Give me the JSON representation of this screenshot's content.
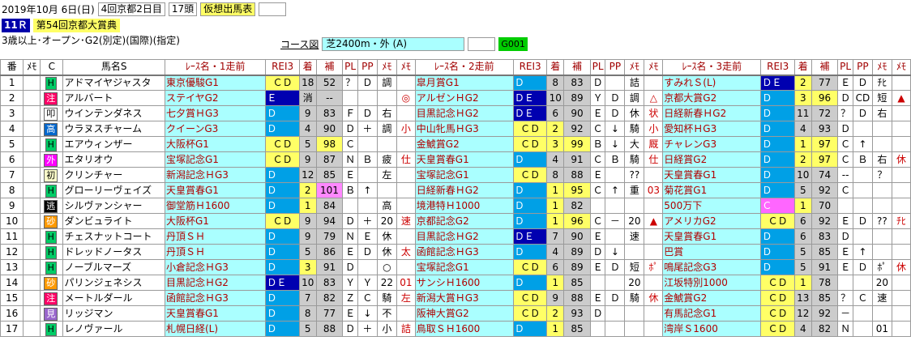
{
  "header": {
    "date": "2019年10月 6日(日)",
    "meeting": "4回京都2日目",
    "heads": "17頭",
    "kaso": "仮想出馬表",
    "race_no": "11Ｒ",
    "race_name": "第54回京都大賞典",
    "conditions": "3歳以上･オープン･G2(別定)(国際)(指定)",
    "course_label": "コース図",
    "course": "芝2400m・外 (A)",
    "code": "G001"
  },
  "columns": [
    "番",
    "ﾒﾓ",
    "C",
    "馬名S",
    "ﾚｰｽ名・1走前",
    "REI3",
    "着",
    "補",
    "PL",
    "PP",
    "ﾒﾓ",
    "ﾒﾓ",
    "ﾚｰｽ名・2走前",
    "REI3",
    "着",
    "補",
    "PL",
    "PP",
    "ﾒﾓ",
    "ﾒﾓ",
    "ﾚｰｽ名・3走前",
    "REI3",
    "着",
    "補",
    "PL",
    "PP",
    "ﾒﾓ",
    "ﾒﾓ"
  ],
  "rows": [
    {
      "no": "1",
      "mark": "H",
      "name": "アドマイヤジャスタ",
      "r": [
        [
          "東京優駿G1",
          "ＣＤ",
          "18",
          "52",
          "？",
          "Ｄ",
          "調",
          ""
        ],
        [
          "皐月賞G1",
          "Ｄ",
          "8",
          "83",
          "Ｄ",
          "",
          "詰",
          ""
        ],
        [
          "すみれＳ(L)",
          "ＤＥ",
          "2",
          "77",
          "Ｅ",
          "Ｄ",
          "ﾁﾋ",
          ""
        ]
      ]
    },
    {
      "no": "2",
      "mark": "注",
      "name": "アルバート",
      "r": [
        [
          "ステイヤG2",
          "Ｅ",
          "消",
          "--",
          "",
          "",
          "",
          "◎"
        ],
        [
          "アルゼンＨG2",
          "ＤＥ",
          "10",
          "89",
          "Ｙ",
          "Ｄ",
          "調",
          "△"
        ],
        [
          "京都大賞G2",
          "Ｄ",
          "3",
          "96",
          "Ｄ",
          "CD",
          "短",
          "▲"
        ]
      ]
    },
    {
      "no": "3",
      "mark": "叩",
      "name": "ウインテンダネス",
      "r": [
        [
          "七夕賞ＨG3",
          "Ｄ",
          "9",
          "83",
          "Ｆ",
          "Ｄ",
          "右",
          ""
        ],
        [
          "目黒記念ＨG2",
          "ＤＥ",
          "6",
          "90",
          "Ｅ",
          "Ｄ",
          "休",
          "状"
        ],
        [
          "日経新春ＨG2",
          "Ｄ",
          "11",
          "72",
          "？",
          "Ｄ",
          "右",
          ""
        ]
      ]
    },
    {
      "no": "4",
      "mark": "高",
      "name": "ウラヌスチャーム",
      "r": [
        [
          "クイーンG3",
          "Ｄ",
          "4",
          "90",
          "Ｄ",
          "＋",
          "調",
          "小"
        ],
        [
          "中山牝馬ＨG3",
          "ＣＤ",
          "2",
          "92",
          "Ｃ",
          "↓",
          "騎",
          "小"
        ],
        [
          "愛知杯ＨG3",
          "Ｄ",
          "4",
          "93",
          "Ｄ",
          "",
          "",
          ""
        ]
      ]
    },
    {
      "no": "5",
      "mark": "H",
      "name": "エアウィンザー",
      "r": [
        [
          "大阪杯G1",
          "ＣＤ",
          "5",
          "98",
          "Ｃ",
          "",
          "",
          ""
        ],
        [
          "金鯱賞G2",
          "ＣＤ",
          "3",
          "99",
          "Ｂ",
          "↓",
          "大",
          "厩"
        ],
        [
          "チャレンG3",
          "Ｄ",
          "1",
          "97",
          "Ｃ",
          "↑",
          "",
          ""
        ]
      ]
    },
    {
      "no": "6",
      "mark": "外",
      "name": "エタリオウ",
      "r": [
        [
          "宝塚記念G1",
          "ＣＤ",
          "9",
          "87",
          "Ｎ",
          "Ｂ",
          "疲",
          "仕"
        ],
        [
          "天皇賞春G1",
          "Ｄ",
          "4",
          "91",
          "Ｃ",
          "Ｂ",
          "騎",
          "仕"
        ],
        [
          "日経賞G2",
          "Ｄ",
          "2",
          "97",
          "Ｃ",
          "Ｂ",
          "右",
          "休"
        ]
      ]
    },
    {
      "no": "7",
      "mark": "初",
      "name": "クリンチャー",
      "r": [
        [
          "新潟記念ＨG3",
          "Ｄ",
          "12",
          "85",
          "Ｅ",
          "",
          "左",
          ""
        ],
        [
          "宝塚記念G1",
          "ＣＤ",
          "8",
          "88",
          "Ｅ",
          "",
          "??",
          ""
        ],
        [
          "天皇賞春G1",
          "Ｄ",
          "10",
          "74",
          "--",
          "",
          "？",
          ""
        ]
      ]
    },
    {
      "no": "8",
      "mark": "H",
      "name": "グローリーヴェイズ",
      "r": [
        [
          "天皇賞春G1",
          "Ｄ",
          "2",
          "101",
          "Ｂ",
          "↑",
          "",
          ""
        ],
        [
          "日経新春ＨG2",
          "Ｄ",
          "1",
          "95",
          "Ｃ",
          "↑",
          "重",
          "03"
        ],
        [
          "菊花賞G1",
          "Ｄ",
          "5",
          "92",
          "Ｃ",
          "",
          "",
          ""
        ]
      ]
    },
    {
      "no": "9",
      "mark": "逃",
      "name": "シルヴァンシャー",
      "r": [
        [
          "御堂筋Ｈ1600",
          "Ｄ",
          "1",
          "84",
          "",
          "",
          "高",
          ""
        ],
        [
          "境港特Ｈ1000",
          "Ｄ",
          "1",
          "82",
          "",
          "",
          "",
          ""
        ],
        [
          "500万下",
          "Ｃ",
          "1",
          "70",
          "",
          "",
          "",
          ""
        ]
      ]
    },
    {
      "no": "10",
      "mark": "砂",
      "name": "ダンビュライト",
      "r": [
        [
          "大阪杯G1",
          "ＣＤ",
          "9",
          "94",
          "Ｄ",
          "＋",
          "20",
          "速"
        ],
        [
          "京都記念G2",
          "Ｄ",
          "1",
          "96",
          "Ｃ",
          "－",
          "20",
          "▲"
        ],
        [
          "アメリカG2",
          "ＣＤ",
          "6",
          "92",
          "Ｅ",
          "Ｄ",
          "??",
          "ﾁﾋ"
        ]
      ]
    },
    {
      "no": "11",
      "mark": "H",
      "name": "チェスナットコート",
      "r": [
        [
          "丹頂ＳＨ",
          "Ｄ",
          "9",
          "79",
          "Ｎ",
          "Ｅ",
          "休",
          ""
        ],
        [
          "目黒記念ＨG2",
          "ＤＥ",
          "7",
          "90",
          "Ｅ",
          "",
          "速",
          ""
        ],
        [
          "天皇賞春G1",
          "Ｄ",
          "6",
          "83",
          "Ｄ",
          "",
          "",
          ""
        ]
      ]
    },
    {
      "no": "12",
      "mark": "H",
      "name": "ドレッドノータス",
      "r": [
        [
          "丹頂ＳＨ",
          "Ｄ",
          "5",
          "86",
          "Ｅ",
          "Ｄ",
          "休",
          "太"
        ],
        [
          "函館記念ＨG3",
          "Ｄ",
          "4",
          "89",
          "Ｄ",
          "↓",
          "",
          ""
        ],
        [
          "巴賞",
          "Ｄ",
          "5",
          "85",
          "Ｅ",
          "↑",
          "",
          ""
        ]
      ]
    },
    {
      "no": "13",
      "mark": "H",
      "name": "ノーブルマーズ",
      "r": [
        [
          "小倉記念ＨG3",
          "Ｄ",
          "3",
          "91",
          "Ｄ",
          "",
          "○",
          ""
        ],
        [
          "宝塚記念G1",
          "ＣＤ",
          "6",
          "89",
          "Ｅ",
          "Ｄ",
          "短",
          "ﾎﾟ"
        ],
        [
          "鳴尾記念G3",
          "Ｄ",
          "5",
          "91",
          "Ｅ",
          "Ｄ",
          "ﾎﾟ",
          "休"
        ]
      ]
    },
    {
      "no": "14",
      "mark": "砂",
      "name": "パリンジェネシス",
      "r": [
        [
          "目黒記念ＨG2",
          "ＤＥ",
          "10",
          "83",
          "Ｙ",
          "Ｙ",
          "22",
          "01"
        ],
        [
          "サンシＨ1600",
          "Ｄ",
          "1",
          "85",
          "",
          "",
          "20",
          ""
        ],
        [
          "江坂特別1000",
          "ＣＤ",
          "1",
          "78",
          "",
          "",
          "20",
          ""
        ]
      ]
    },
    {
      "no": "15",
      "mark": "注",
      "name": "メートルダール",
      "r": [
        [
          "函館記念ＨG3",
          "Ｄ",
          "7",
          "82",
          "Ｚ",
          "Ｃ",
          "騎",
          "左"
        ],
        [
          "新潟大賞ＨG3",
          "ＣＤ",
          "9",
          "88",
          "Ｅ",
          "Ｄ",
          "騎",
          "休"
        ],
        [
          "金鯱賞G2",
          "ＣＤ",
          "13",
          "85",
          "？",
          "Ｃ",
          "速",
          ""
        ]
      ]
    },
    {
      "no": "16",
      "mark": "見",
      "name": "リッジマン",
      "r": [
        [
          "天皇賞春G1",
          "Ｄ",
          "8",
          "77",
          "Ｅ",
          "↓",
          "不",
          ""
        ],
        [
          "阪神大賞G2",
          "ＣＤ",
          "2",
          "93",
          "Ｄ",
          "",
          "",
          ""
        ],
        [
          "有馬記念G1",
          "ＣＤ",
          "12",
          "92",
          "－",
          "",
          "",
          ""
        ]
      ]
    },
    {
      "no": "17",
      "mark": "H",
      "name": "レノヴァール",
      "r": [
        [
          "札幌日経(L)",
          "Ｄ",
          "5",
          "88",
          "Ｄ",
          "＋",
          "小",
          "詰"
        ],
        [
          "鳥取ＳＨ1600",
          "Ｄ",
          "1",
          "85",
          "",
          "",
          "",
          ""
        ],
        [
          "湾岸Ｓ1600",
          "ＣＤ",
          "4",
          "82",
          "Ｎ",
          "",
          "01",
          ""
        ]
      ]
    }
  ]
}
